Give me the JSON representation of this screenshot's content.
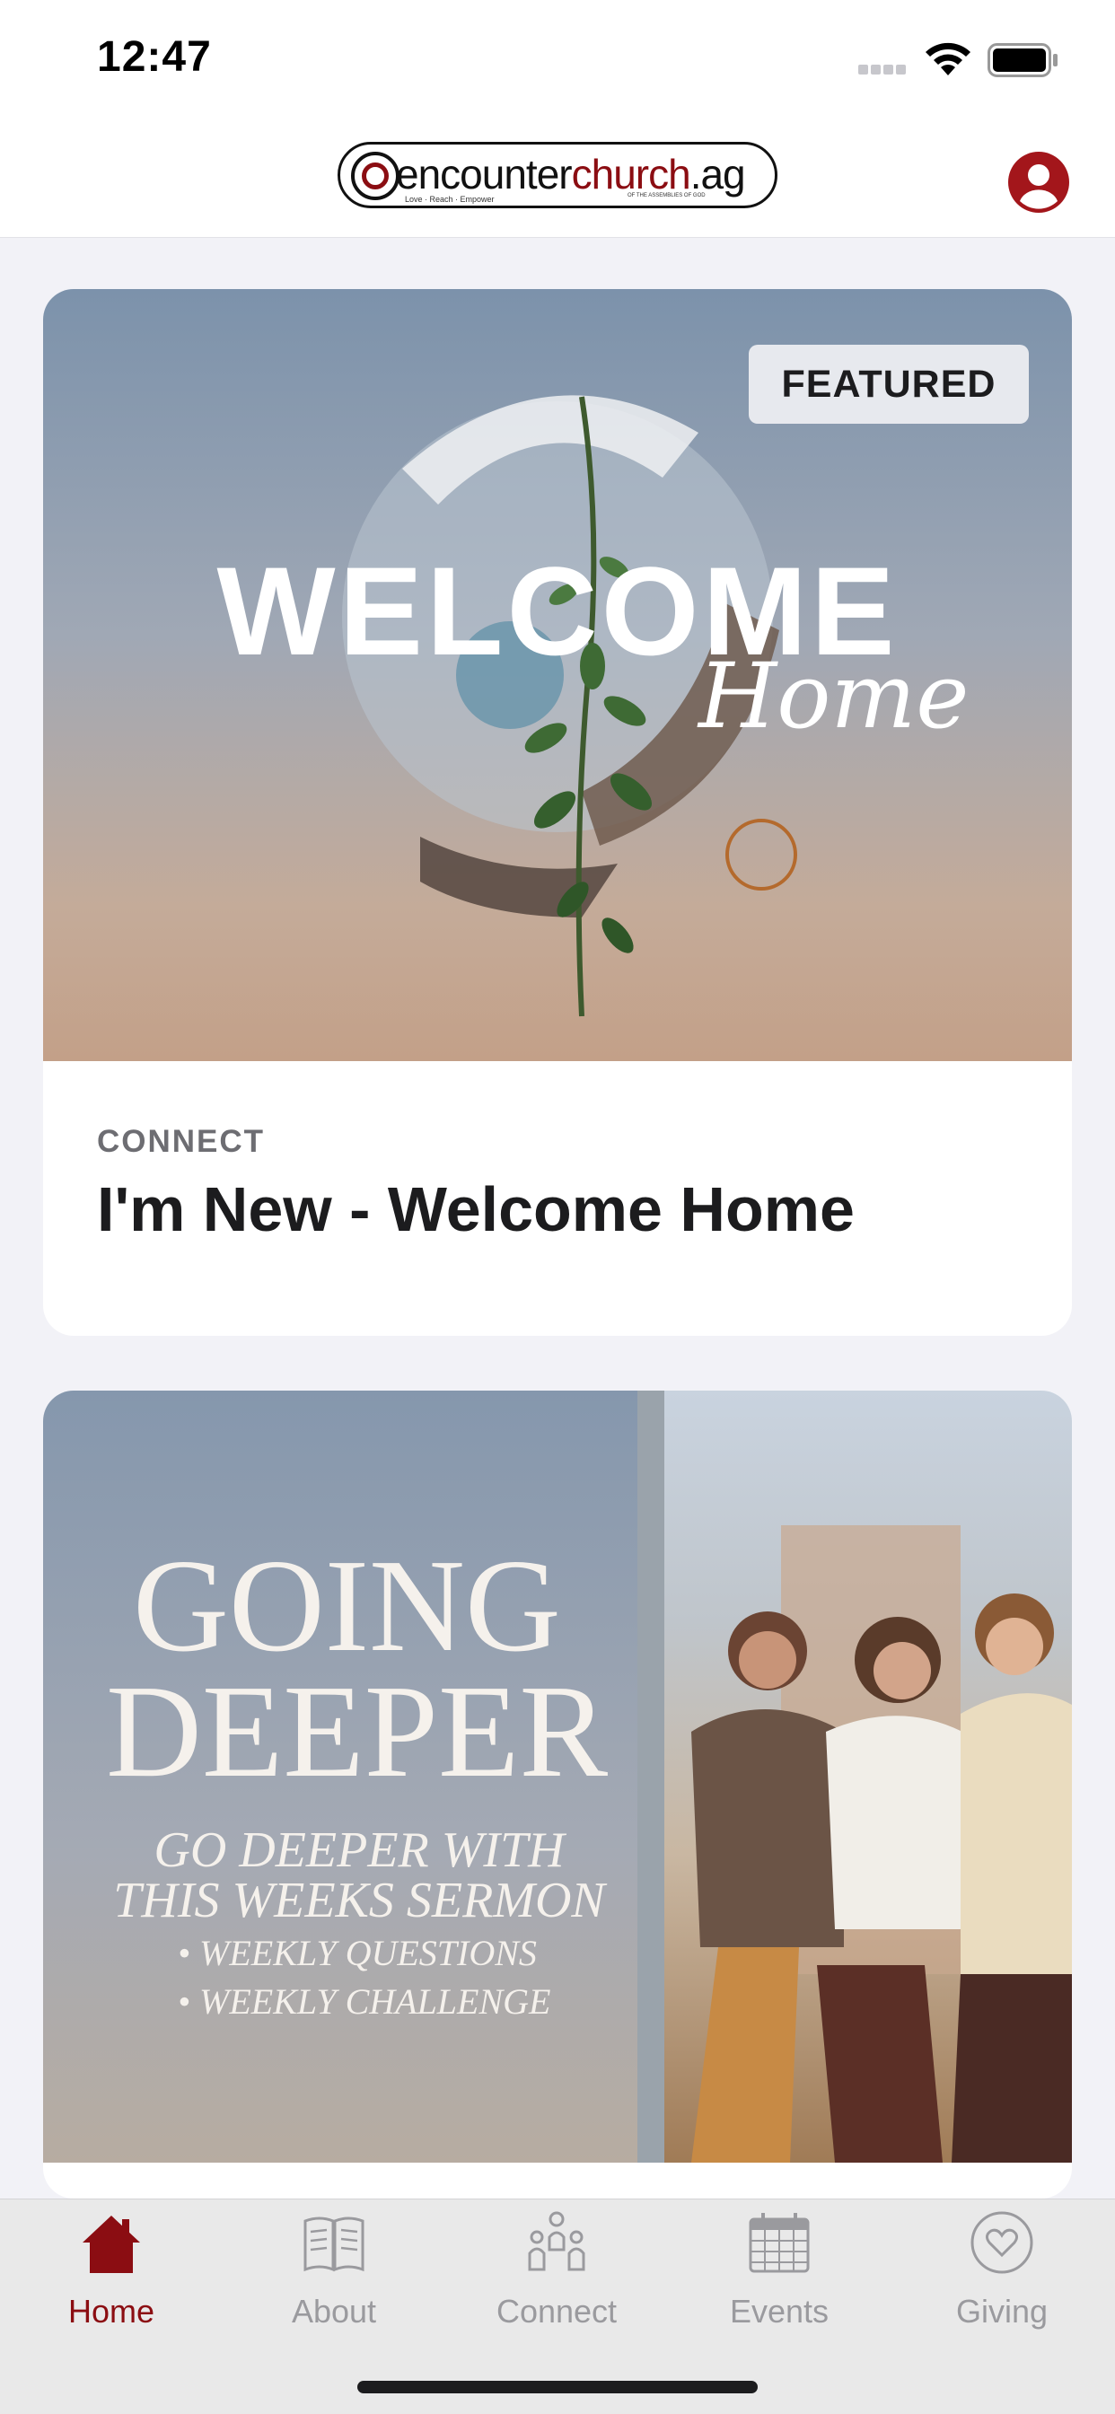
{
  "status_bar": {
    "time": "12:47"
  },
  "header": {
    "logo": {
      "text_dark_1": "encoun",
      "text_dark_2": "ter",
      "text_red": "church",
      "text_dark_3": ".ag",
      "tagline": "Love · Reach · Empower",
      "sub": "OF THE ASSEMBLIES OF GOD"
    },
    "profile_icon": "person-circle-icon"
  },
  "cards": [
    {
      "badge": "FEATURED",
      "image_title": "WELCOME",
      "image_script": "Home",
      "category": "CONNECT",
      "title": "I'm New - Welcome Home"
    },
    {
      "image_title_line1": "GOING",
      "image_title_line2": "DEEPER",
      "image_sub_line1": "GO DEEPER WITH",
      "image_sub_line2": "THIS WEEKS SERMON",
      "bullet1": "• WEEKLY QUESTIONS",
      "bullet2": "• WEEKLY CHALLENGE"
    }
  ],
  "tabs": [
    {
      "label": "Home",
      "icon": "house-icon",
      "active": true
    },
    {
      "label": "About",
      "icon": "book-icon",
      "active": false
    },
    {
      "label": "Connect",
      "icon": "people-icon",
      "active": false
    },
    {
      "label": "Events",
      "icon": "calendar-icon",
      "active": false
    },
    {
      "label": "Giving",
      "icon": "heart-circle-icon",
      "active": false
    }
  ],
  "colors": {
    "accent": "#8b0d12",
    "tab_inactive": "#9a9a9e",
    "background": "#f2f2f7"
  }
}
